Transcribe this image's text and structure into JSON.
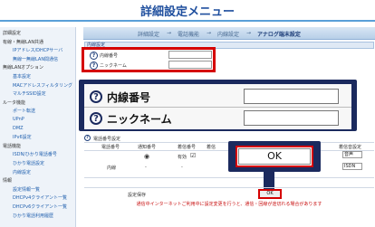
{
  "header": {
    "title": "詳細設定メニュー"
  },
  "breadcrumb": {
    "items": [
      "詳細設定",
      "電話機能",
      "内線設定",
      "アナログ端末設定"
    ],
    "separator": "→"
  },
  "sidebar": {
    "items": [
      {
        "label": "詳細設定",
        "sub": false
      },
      {
        "label": "有線・無線LAN共通",
        "sub": false
      },
      {
        "label": "IPアドレス/DHCPサーバ",
        "sub": true
      },
      {
        "label": "無線一無線LAN間通信",
        "sub": true
      },
      {
        "label": "無線LANオプション",
        "sub": false
      },
      {
        "label": "基本設定",
        "sub": true
      },
      {
        "label": "MACアドレスフィルタリング",
        "sub": true
      },
      {
        "label": "マルチSSID設定",
        "sub": true
      },
      {
        "label": "ルータ機能",
        "sub": false
      },
      {
        "label": "ポート転送",
        "sub": true
      },
      {
        "label": "UPnP",
        "sub": true
      },
      {
        "label": "DMZ",
        "sub": true
      },
      {
        "label": "IPv6設定",
        "sub": true
      },
      {
        "label": "電話機能",
        "sub": false
      },
      {
        "label": "ISDN/ひかり電話番号",
        "sub": true
      },
      {
        "label": "ひかり電話設定",
        "sub": true
      },
      {
        "label": "内線設定",
        "sub": true
      },
      {
        "label": "情報",
        "sub": false
      },
      {
        "label": "設定情報一覧",
        "sub": true
      },
      {
        "label": "DHCPv4クライアント一覧",
        "sub": true
      },
      {
        "label": "DHCPv6クライアント一覧",
        "sub": true
      },
      {
        "label": "ひかり電話利用履歴",
        "sub": true
      }
    ]
  },
  "section1": {
    "title": "内線設定",
    "rows": [
      "内線番号",
      "ニックネーム"
    ]
  },
  "zoom": {
    "rows": [
      "内線番号",
      "ニックネーム"
    ]
  },
  "section2": {
    "title": "電話番号設定",
    "headers": [
      "電話番号",
      "通知番号",
      "",
      "着信番号",
      "着信",
      "着信音設定"
    ],
    "row": {
      "label": "内線",
      "v1": "-",
      "v2": "-",
      "v3": "有効"
    },
    "selects": [
      "音声",
      "ISDN"
    ]
  },
  "ok": {
    "label": "OK",
    "small_label": "OK"
  },
  "save": {
    "label": "設定保存"
  },
  "warning": {
    "text": "通信中インターネットご利用中に設定変更を行うと、通信・回線が途切れる場合があります"
  }
}
